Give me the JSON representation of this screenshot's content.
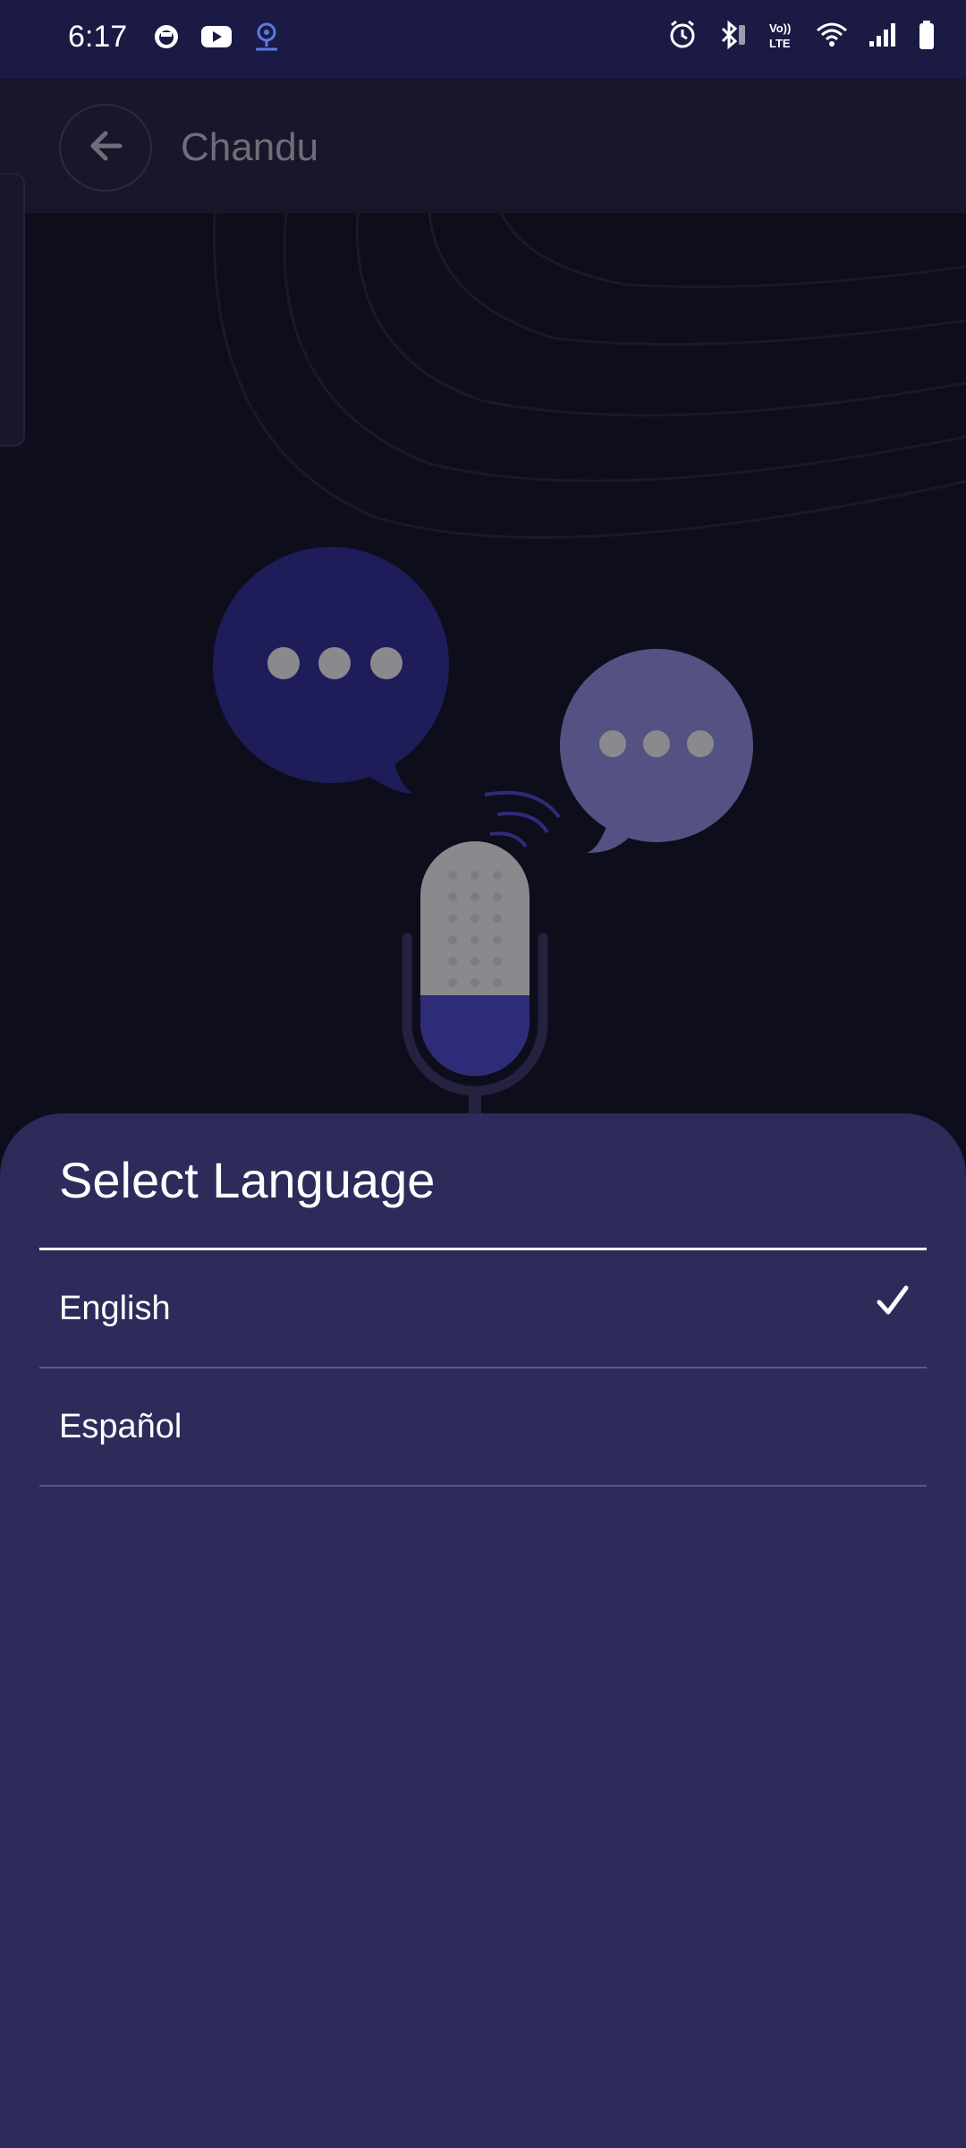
{
  "status_bar": {
    "time": "6:17",
    "left_icons": [
      "app-notification-icon",
      "youtube-icon",
      "location-pin-icon"
    ],
    "right_icons": [
      "alarm-icon",
      "bluetooth-icon",
      "volte-icon",
      "wifi-icon",
      "signal-icon",
      "battery-icon"
    ],
    "volte_top": "Vo))",
    "volte_bottom": "LTE"
  },
  "app_bar": {
    "title": "Chandu",
    "back_icon": "arrow-left-icon"
  },
  "sheet": {
    "title": "Select Language",
    "options": [
      {
        "label": "English",
        "selected": true
      },
      {
        "label": "Español",
        "selected": false
      }
    ]
  },
  "colors": {
    "status_bar": "#1b1a45",
    "background": "#0e0d1c",
    "sheet": "#2d2b5a",
    "bubble_primary": "#1e1d5a",
    "bubble_secondary": "#545283",
    "mic_accent": "#2e2c78"
  }
}
